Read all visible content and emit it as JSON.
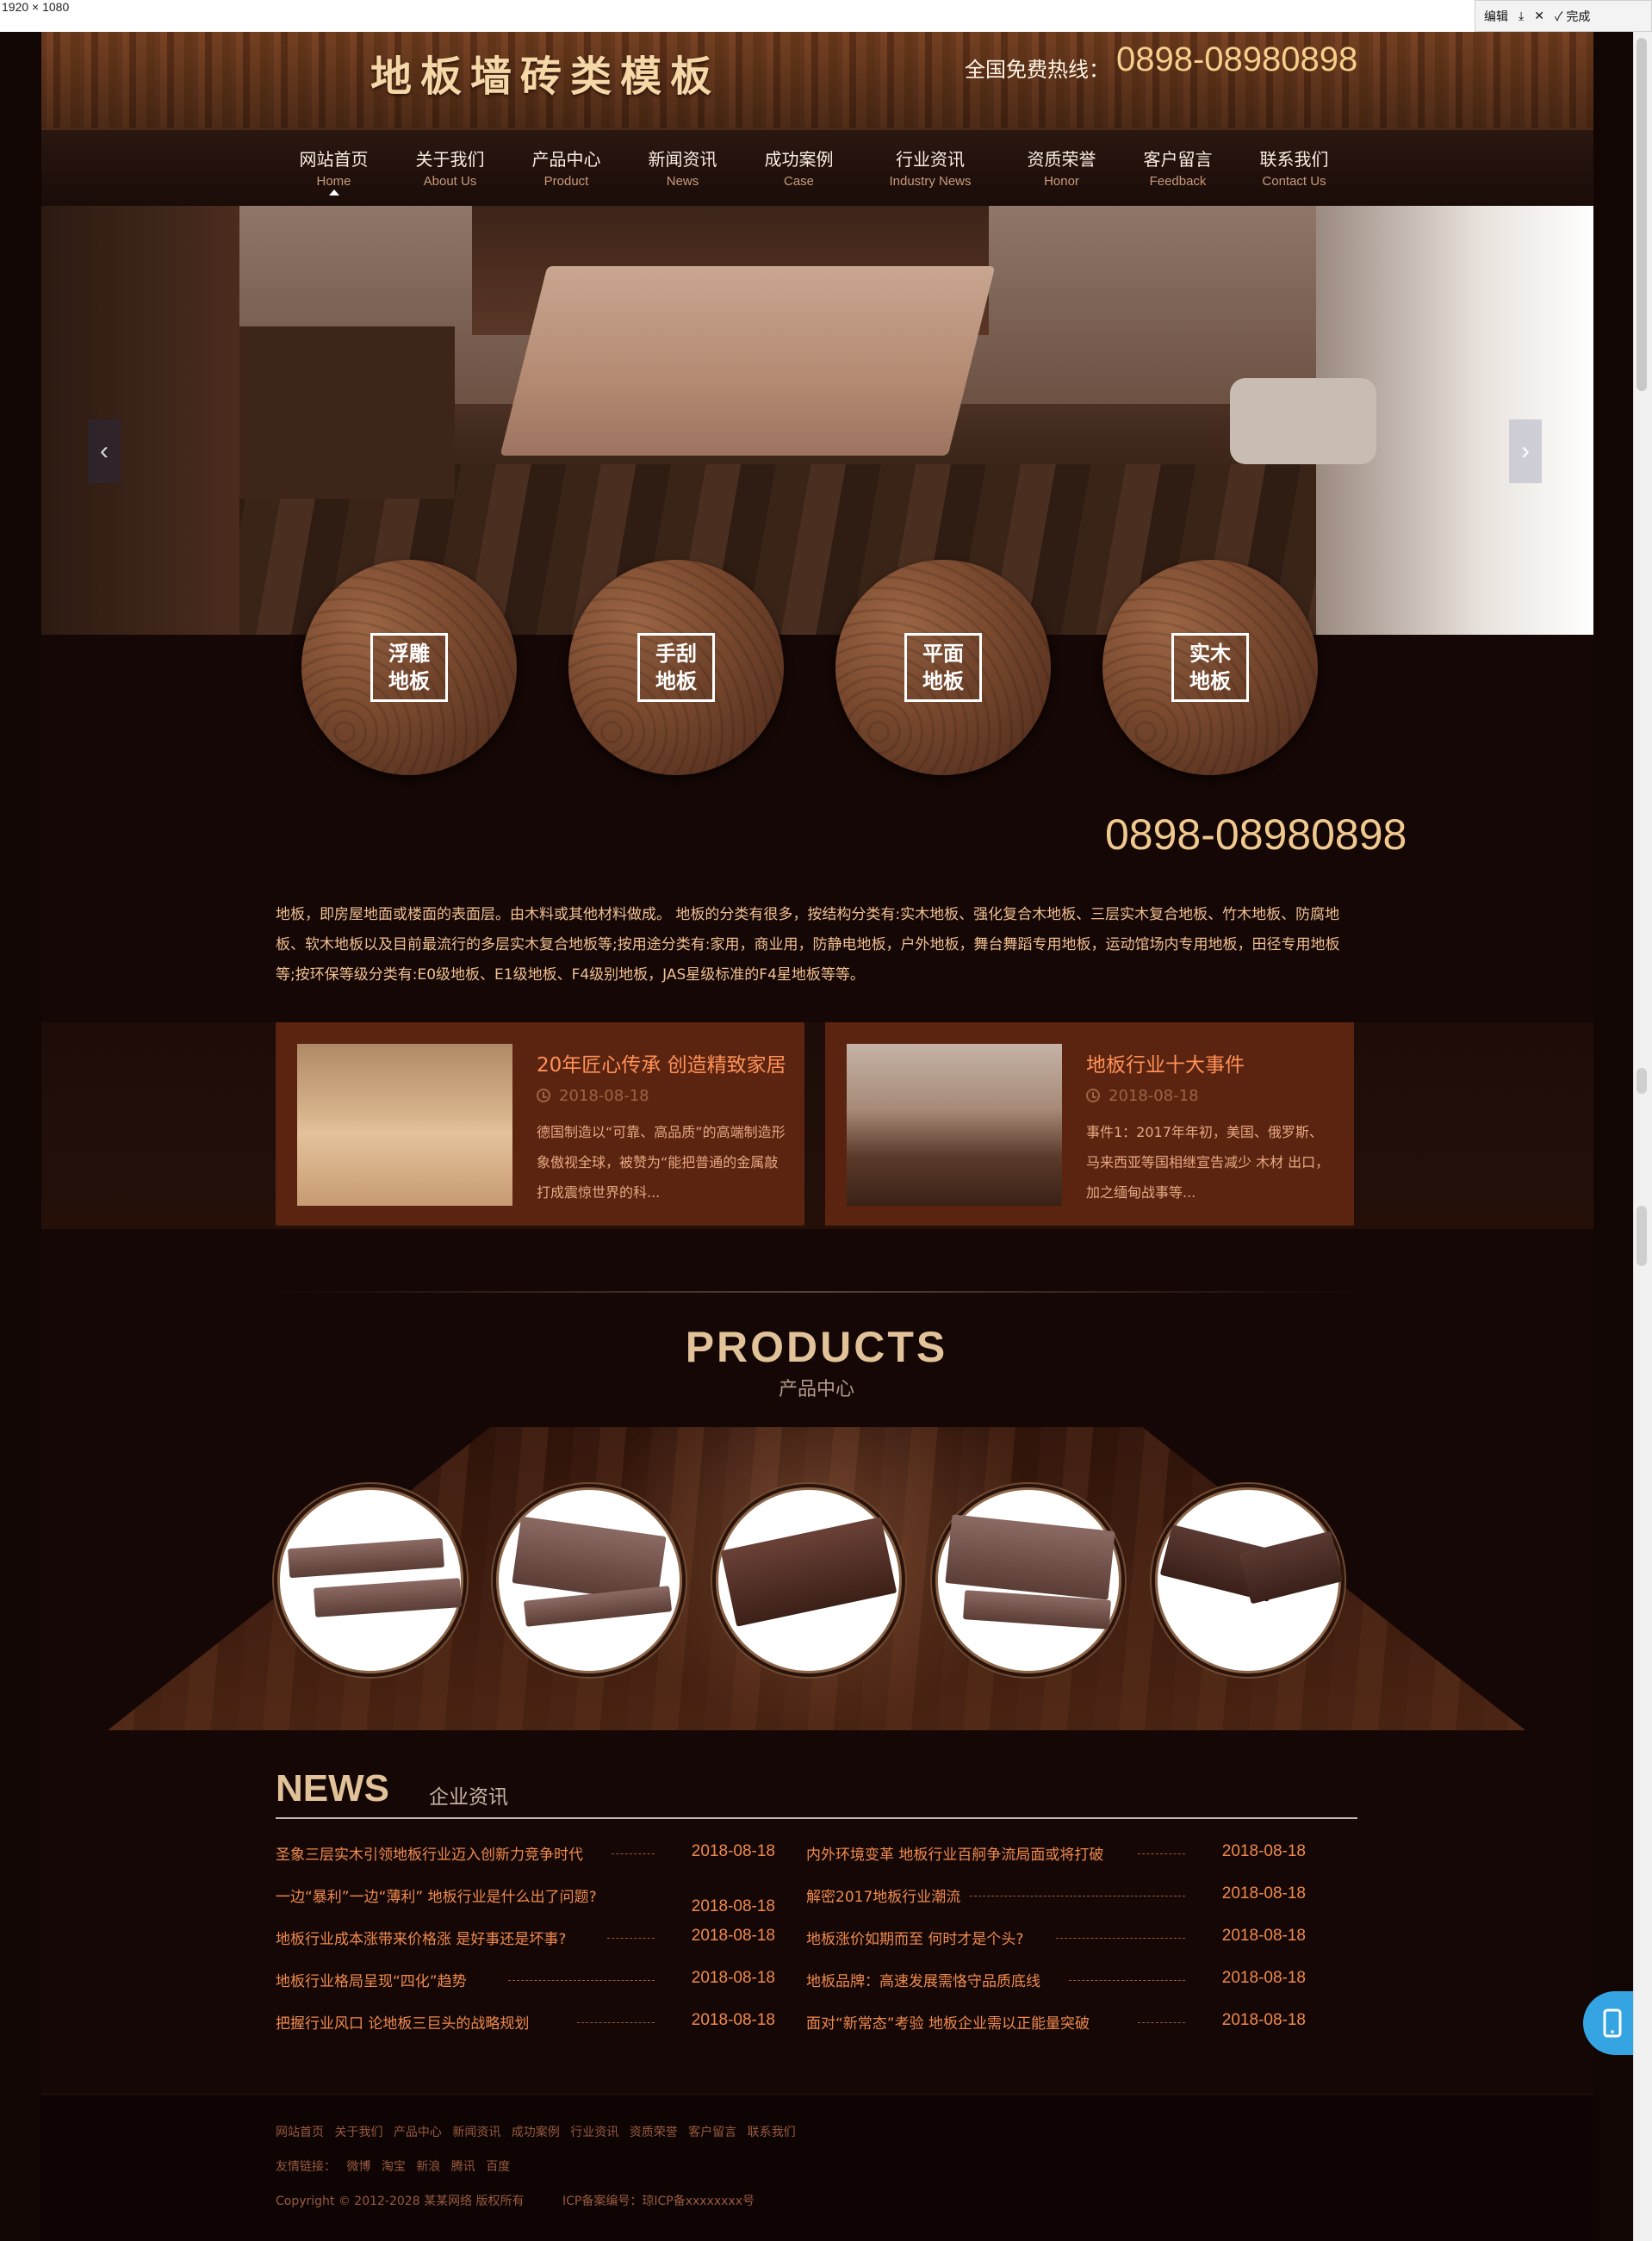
{
  "screenshot": {
    "dim_label": "1920 × 1080"
  },
  "toolbar": {
    "edit": "编辑",
    "download": "⤓",
    "close": "✕",
    "done": "✓ 完成"
  },
  "header": {
    "logo": "地板墙砖类模板",
    "hotline_label": "全国免费热线：",
    "hotline_number": "0898-08980898"
  },
  "nav": [
    {
      "cn": "网站首页",
      "en": "Home"
    },
    {
      "cn": "关于我们",
      "en": "About Us"
    },
    {
      "cn": "产品中心",
      "en": "Product"
    },
    {
      "cn": "新闻资讯",
      "en": "News"
    },
    {
      "cn": "成功案例",
      "en": "Case"
    },
    {
      "cn": "行业资讯",
      "en": "Industry News"
    },
    {
      "cn": "资质荣誉",
      "en": "Honor"
    },
    {
      "cn": "客户留言",
      "en": "Feedback"
    },
    {
      "cn": "联系我们",
      "en": "Contact Us"
    }
  ],
  "banner": {
    "prev": "‹",
    "next": "›"
  },
  "categories": [
    {
      "line1": "浮雕",
      "line2": "地板"
    },
    {
      "line1": "手刮",
      "line2": "地板"
    },
    {
      "line1": "平面",
      "line2": "地板"
    },
    {
      "line1": "实木",
      "line2": "地板"
    }
  ],
  "contact": {
    "phone": "0898-08980898"
  },
  "intro": "地板，即房屋地面或楼面的表面层。由木料或其他材料做成。 地板的分类有很多，按结构分类有:实木地板、强化复合木地板、三层实木复合地板、竹木地板、防腐地板、软木地板以及目前最流行的多层实木复合地板等;按用途分类有:家用，商业用，防静电地板，户外地板，舞台舞蹈专用地板，运动馆场内专用地板，田径专用地板等;按环保等级分类有:E0级地板、E1级地板、F4级别地板，JAS星级标准的F4星地板等等。",
  "features": [
    {
      "title": "20年匠心传承 创造精致家居",
      "date": "2018-08-18",
      "desc": "德国制造以“可靠、高品质”的高端制造形象傲视全球，被赞为“能把普通的金属敲打成震惊世界的科..."
    },
    {
      "title": "地板行业十大事件",
      "date": "2018-08-18",
      "desc": "事件1：2017年年初，美国、俄罗斯、马来西亚等国相继宣告减少 木材 出口，加之缅甸战事等..."
    }
  ],
  "products": {
    "title": "PRODUCTS",
    "subtitle": "产品中心"
  },
  "news": {
    "title": "NEWS",
    "subtitle": "企业资讯",
    "left": [
      {
        "title": "圣象三层实木引领地板行业迈入创新力竞争时代",
        "date": "2018-08-18"
      },
      {
        "title": "一边“暴利”一边“薄利” 地板行业是什么出了问题?",
        "date": "2018-08-18"
      },
      {
        "title": "地板行业成本涨带来价格涨 是好事还是坏事?",
        "date": "2018-08-18"
      },
      {
        "title": "地板行业格局呈现“四化”趋势",
        "date": "2018-08-18"
      },
      {
        "title": "把握行业风口 论地板三巨头的战略规划",
        "date": "2018-08-18"
      }
    ],
    "right": [
      {
        "title": "内外环境变革 地板行业百舸争流局面或将打破",
        "date": "2018-08-18"
      },
      {
        "title": "解密2017地板行业潮流",
        "date": "2018-08-18"
      },
      {
        "title": "地板涨价如期而至 何时才是个头?",
        "date": "2018-08-18"
      },
      {
        "title": "地板品牌：高速发展需恪守品质底线",
        "date": "2018-08-18"
      },
      {
        "title": "面对“新常态”考验 地板企业需以正能量突破",
        "date": "2018-08-18"
      }
    ]
  },
  "footer": {
    "links": "网站首页 关于我们 产品中心 新闻资讯 成功案例 行业资讯 资质荣誉 客户留言 联系我们",
    "friend_links": "友情链接： 微博 淘宝 新浪 腾讯 百度",
    "copyright": "Copyright © 2012-2028 某某网络 版权所有          ICP备案编号：琼ICP备xxxxxxxx号"
  }
}
